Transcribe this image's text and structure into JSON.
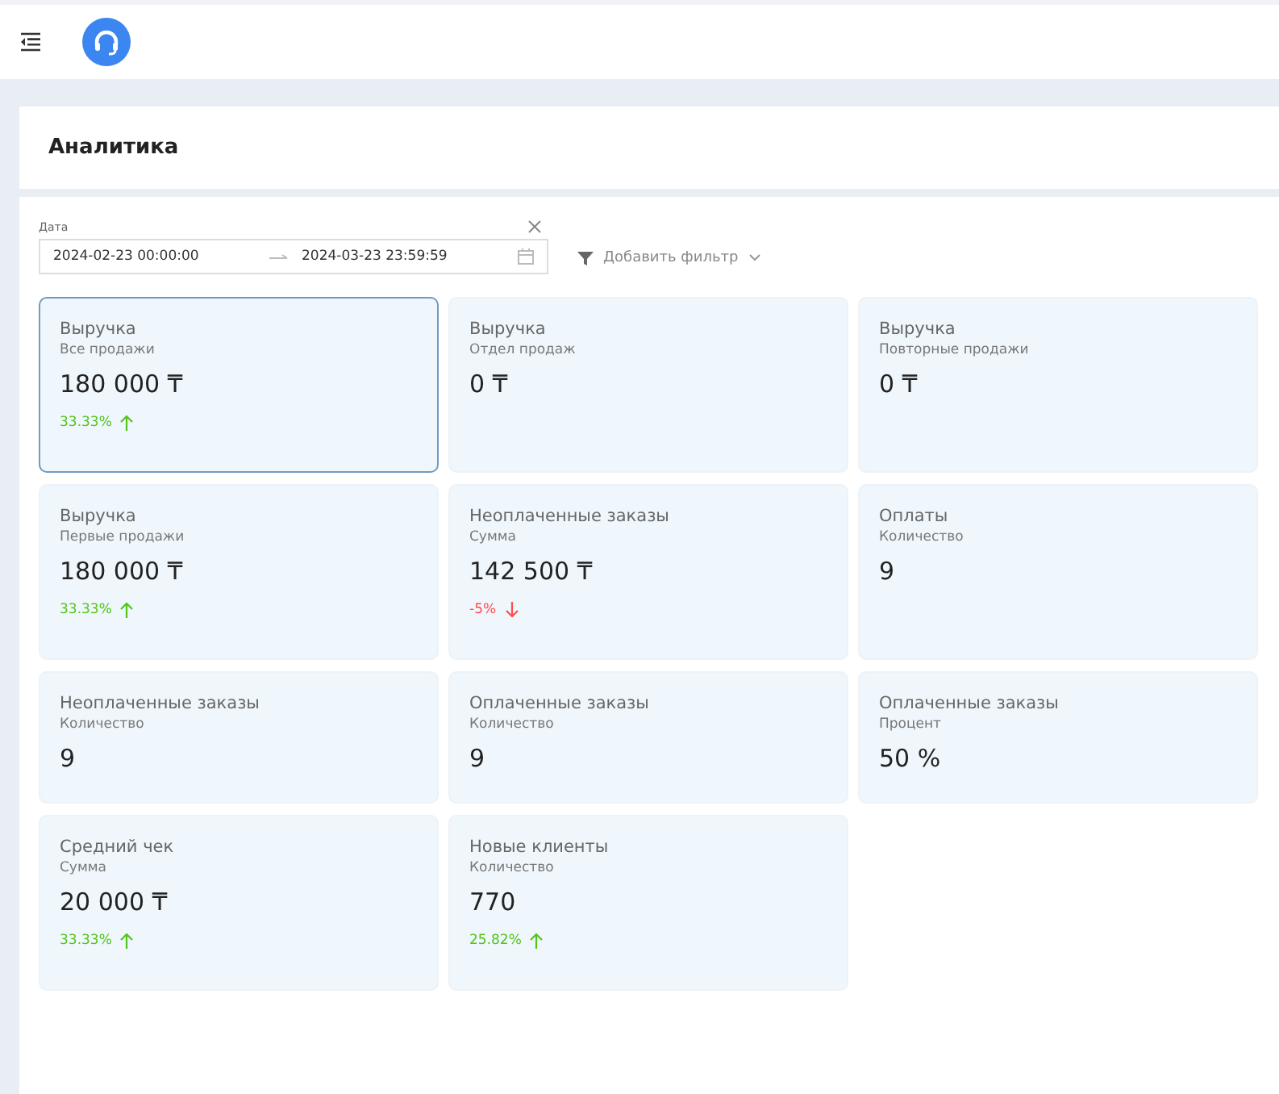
{
  "page_title": "Аналитика",
  "date_filter": {
    "label": "Дата",
    "start": "2024-02-23 00:00:00",
    "end": "2024-03-23 23:59:59"
  },
  "add_filter": "Добавить фильтр",
  "cards": [
    {
      "title": "Выручка",
      "subtitle": "Все продажи",
      "value": "180 000 ₸",
      "change": "33.33%",
      "kind": "up",
      "selected": true
    },
    {
      "title": "Выручка",
      "subtitle": "Отдел продаж",
      "value": "0 ₸",
      "selected": false
    },
    {
      "title": "Выручка",
      "subtitle": "Повторные продажи",
      "value": "0 ₸",
      "selected": false
    },
    {
      "title": "Выручка",
      "subtitle": "Первые продажи",
      "value": "180 000 ₸",
      "change": "33.33%",
      "kind": "up",
      "selected": false
    },
    {
      "title": "Неоплаченные заказы",
      "subtitle": "Сумма",
      "value": "142 500 ₸",
      "change": "-5%",
      "kind": "down",
      "selected": false
    },
    {
      "title": "Оплаты",
      "subtitle": "Количество",
      "value": "9",
      "selected": false
    },
    {
      "title": "Неоплаченные заказы",
      "subtitle": "Количество",
      "value": "9",
      "selected": false
    },
    {
      "title": "Оплаченные заказы",
      "subtitle": "Количество",
      "value": "9",
      "selected": false
    },
    {
      "title": "Оплаченные заказы",
      "subtitle": "Процент",
      "value": "50 %",
      "selected": false
    },
    {
      "title": "Средний чек",
      "subtitle": "Сумма",
      "value": "20 000 ₸",
      "change": "33.33%",
      "kind": "up",
      "selected": false
    },
    {
      "title": "Новые клиенты",
      "subtitle": "Количество",
      "value": "770",
      "change": "25.82%",
      "kind": "up",
      "selected": false
    }
  ]
}
